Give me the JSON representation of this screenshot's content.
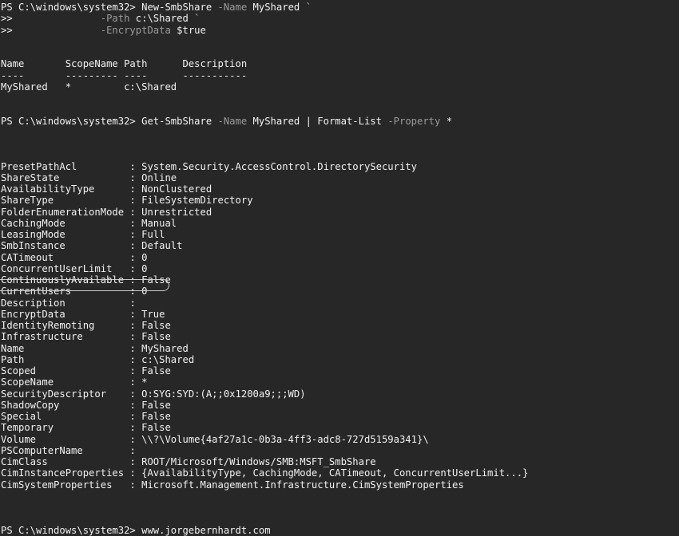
{
  "terminal": {
    "background_color": "#272727",
    "foreground_color": "#f2f2f2",
    "dim_color": "#9b9b9b",
    "prompt": "PS C:\\windows\\system32>",
    "continuation_prompt": ">>"
  },
  "commands": {
    "first": {
      "prompt": "PS C:\\windows\\system32> ",
      "cmdlet": "New-SmbShare",
      "param_name": " -Name",
      "name_value": " MyShared",
      "backtick": " `",
      "cont_prompt": ">>",
      "line2_indent": "               ",
      "line2_param": "-Path",
      "line2_value": " c:\\Shared",
      "line2_backtick": " `",
      "line3_indent": "               ",
      "line3_param": "-EncryptData",
      "line3_value": " $true"
    },
    "second": {
      "prompt": "PS C:\\windows\\system32> ",
      "cmdlet": "Get-SmbShare",
      "param_name": " -Name",
      "name_value": " MyShared",
      "pipe": " | ",
      "cmdlet2": "Format-List",
      "param2": " -Property",
      "value2": " *"
    },
    "final": {
      "prompt": "PS C:\\windows\\system32> ",
      "text": "www.jorgebernhardt.com"
    }
  },
  "share_table": {
    "headers": [
      "Name",
      "ScopeName",
      "Path",
      "Description"
    ],
    "header_line": "Name       ScopeName Path      Description",
    "rule_line": "----       --------- ----      -----------",
    "row_line": "MyShared   *         c:\\Shared",
    "rows": [
      {
        "Name": "MyShared",
        "ScopeName": "*",
        "Path": "c:\\Shared",
        "Description": ""
      }
    ]
  },
  "format_list": {
    "highlighted_property": "EncryptData",
    "properties": [
      {
        "name": "PresetPathAcl",
        "value": "System.Security.AccessControl.DirectorySecurity"
      },
      {
        "name": "ShareState",
        "value": "Online"
      },
      {
        "name": "AvailabilityType",
        "value": "NonClustered"
      },
      {
        "name": "ShareType",
        "value": "FileSystemDirectory"
      },
      {
        "name": "FolderEnumerationMode",
        "value": "Unrestricted"
      },
      {
        "name": "CachingMode",
        "value": "Manual"
      },
      {
        "name": "LeasingMode",
        "value": "Full"
      },
      {
        "name": "SmbInstance",
        "value": "Default"
      },
      {
        "name": "CATimeout",
        "value": "0"
      },
      {
        "name": "ConcurrentUserLimit",
        "value": "0"
      },
      {
        "name": "ContinuouslyAvailable",
        "value": "False"
      },
      {
        "name": "CurrentUsers",
        "value": "0"
      },
      {
        "name": "Description",
        "value": ""
      },
      {
        "name": "EncryptData",
        "value": "True"
      },
      {
        "name": "IdentityRemoting",
        "value": "False"
      },
      {
        "name": "Infrastructure",
        "value": "False"
      },
      {
        "name": "Name",
        "value": "MyShared"
      },
      {
        "name": "Path",
        "value": "c:\\Shared"
      },
      {
        "name": "Scoped",
        "value": "False"
      },
      {
        "name": "ScopeName",
        "value": "*"
      },
      {
        "name": "SecurityDescriptor",
        "value": "O:SYG:SYD:(A;;0x1200a9;;;WD)"
      },
      {
        "name": "ShadowCopy",
        "value": "False"
      },
      {
        "name": "Special",
        "value": "False"
      },
      {
        "name": "Temporary",
        "value": "False"
      },
      {
        "name": "Volume",
        "value": "\\\\?\\Volume{4af27a1c-0b3a-4ff3-adc8-727d5159a341}\\"
      },
      {
        "name": "PSComputerName",
        "value": ""
      },
      {
        "name": "CimClass",
        "value": "ROOT/Microsoft/Windows/SMB:MSFT_SmbShare"
      },
      {
        "name": "CimInstanceProperties",
        "value": "{AvailabilityType, CachingMode, CATimeout, ConcurrentUserLimit...}"
      },
      {
        "name": "CimSystemProperties",
        "value": "Microsoft.Management.Infrastructure.CimSystemProperties"
      }
    ]
  }
}
